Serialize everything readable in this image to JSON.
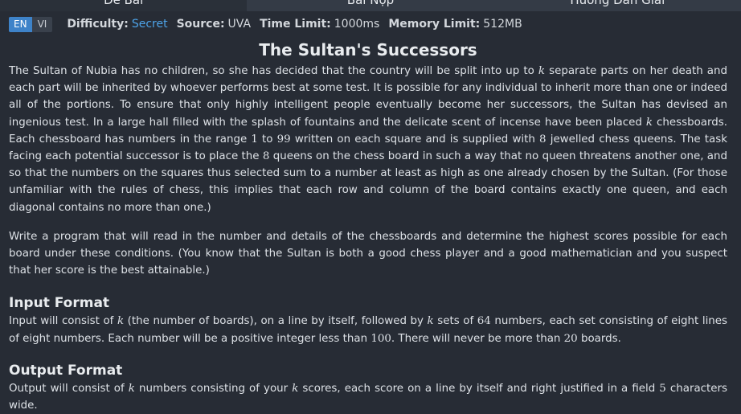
{
  "tabs": [
    "Đề Bài",
    "Bài Nộp",
    "Hướng Dẫn Giải"
  ],
  "lang": {
    "en": "EN",
    "vi": "VI"
  },
  "meta": {
    "difficulty_label": "Difficulty:",
    "difficulty_value": "Secret",
    "source_label": "Source:",
    "source_value": "UVA",
    "time_label": "Time Limit:",
    "time_value": "1000ms",
    "memory_label": "Memory Limit:",
    "memory_value": "512MB"
  },
  "problem": {
    "title": "The Sultan's Successors",
    "p1": [
      "The Sultan of Nubia has no children, so she has decided that the country will be split into up to ",
      "k",
      " separate parts on her death and each part will be inherited by whoever performs best at some test. It is possible for any individual to inherit more than one or indeed all of the portions. To ensure that only highly intelligent people eventually become her successors, the Sultan has devised an ingenious test. In a large hall filled with the splash of fountains and the delicate scent of incense have been placed ",
      "k",
      " chessboards. Each chessboard has numbers in the range ",
      "1",
      " to ",
      "99",
      " written on each square and is supplied with ",
      "8",
      " jewelled chess queens. The task facing each potential successor is to place the ",
      "8",
      " queens on the chess board in such a way that no queen threatens another one, and so that the numbers on the squares thus selected sum to a number at least as high as one already chosen by the Sultan. (For those unfamiliar with the rules of chess, this implies that each row and column of the board contains exactly one queen, and each diagonal contains no more than one.)"
    ],
    "p2": "Write a program that will read in the number and details of the chessboards and determine the highest scores possible for each board under these conditions. (You know that the Sultan is both a good chess player and a good mathematician and you suspect that her score is the best attainable.)",
    "input_heading": "Input Format",
    "input": [
      "Input will consist of ",
      "k",
      " (the number of boards), on a line by itself, followed by ",
      "k",
      " sets of ",
      "64",
      " numbers, each set consisting of eight lines of eight numbers. Each number will be a positive integer less than ",
      "100",
      ". There will never be more than ",
      "20",
      " boards."
    ],
    "output_heading": "Output Format",
    "output": [
      "Output will consist of ",
      "k",
      " numbers consisting of your ",
      "k",
      " scores, each score on a line by itself and right justified in a field ",
      "5",
      " characters wide."
    ]
  }
}
